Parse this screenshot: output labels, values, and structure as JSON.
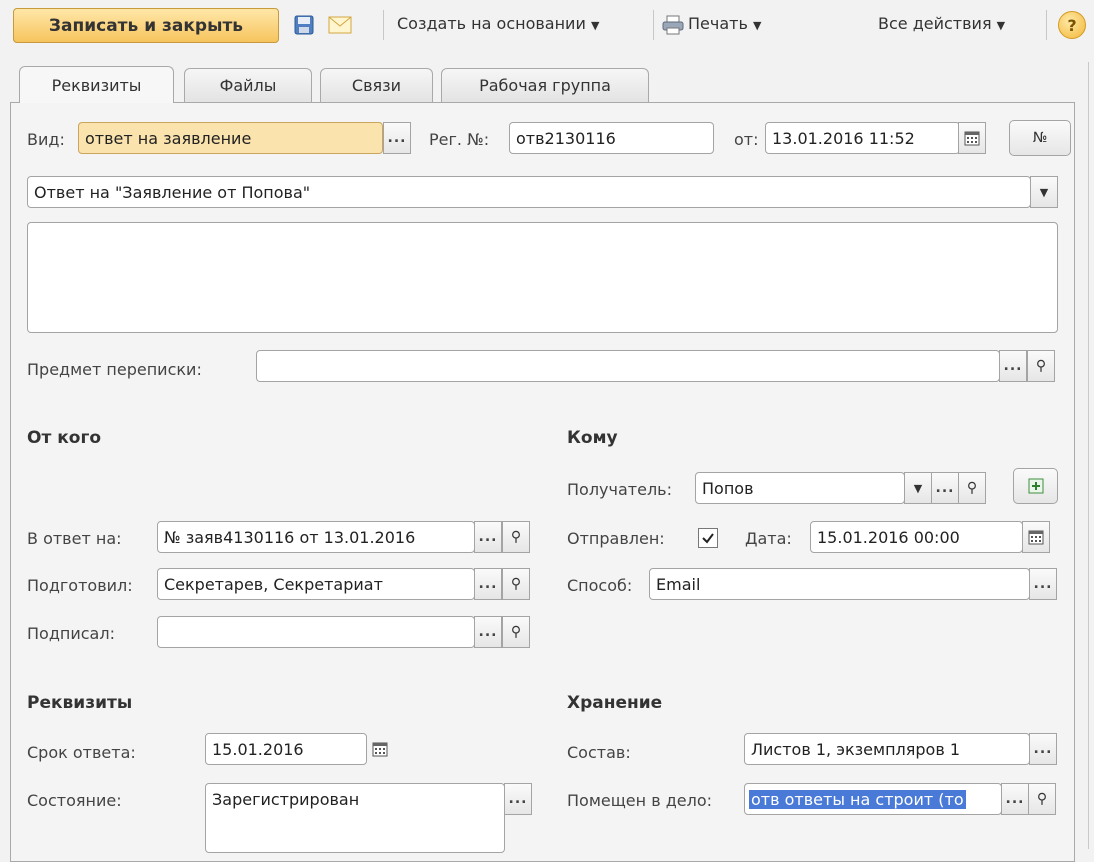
{
  "toolbar": {
    "save_close": "Записать и закрыть",
    "create_based": "Создать на основании",
    "print": "Печать",
    "all_actions": "Все действия",
    "help": "?"
  },
  "tabs": [
    {
      "label": "Реквизиты"
    },
    {
      "label": "Файлы"
    },
    {
      "label": "Связи"
    },
    {
      "label": "Рабочая группа"
    }
  ],
  "header": {
    "vid_label": "Вид:",
    "vid_value": "ответ на заявление",
    "reg_label": "Рег. №:",
    "reg_value": "отв2130116",
    "date_label": "от:",
    "date_value": "13.01.2016 11:52",
    "num_button": "№"
  },
  "title_value": "Ответ на \"Заявление от Попова\"",
  "description_value": "",
  "subject_label": "Предмет переписки:",
  "subject_value": "",
  "from": {
    "heading": "От кого",
    "reply_to_label": "В ответ на:",
    "reply_to_value": "№ заяв4130116 от 13.01.2016",
    "prepared_label": "Подготовил:",
    "prepared_value": "Секретарев, Секретариат",
    "signed_label": "Подписал:",
    "signed_value": ""
  },
  "to": {
    "heading": "Кому",
    "recipient_label": "Получатель:",
    "recipient_value": "Попов",
    "sent_label": "Отправлен:",
    "sent_checked": true,
    "date_label": "Дата:",
    "date_value": "15.01.2016 00:00",
    "method_label": "Способ:",
    "method_value": "Email"
  },
  "requisites": {
    "heading": "Реквизиты",
    "deadline_label": "Срок ответа:",
    "deadline_value": "15.01.2016",
    "state_label": "Состояние:",
    "state_value": "Зарегистрирован"
  },
  "storage": {
    "heading": "Хранение",
    "composition_label": "Состав:",
    "composition_value": "Листов 1, экземпляров 1",
    "case_label": "Помещен в дело:",
    "case_value": "отв ответы на строит (то"
  }
}
